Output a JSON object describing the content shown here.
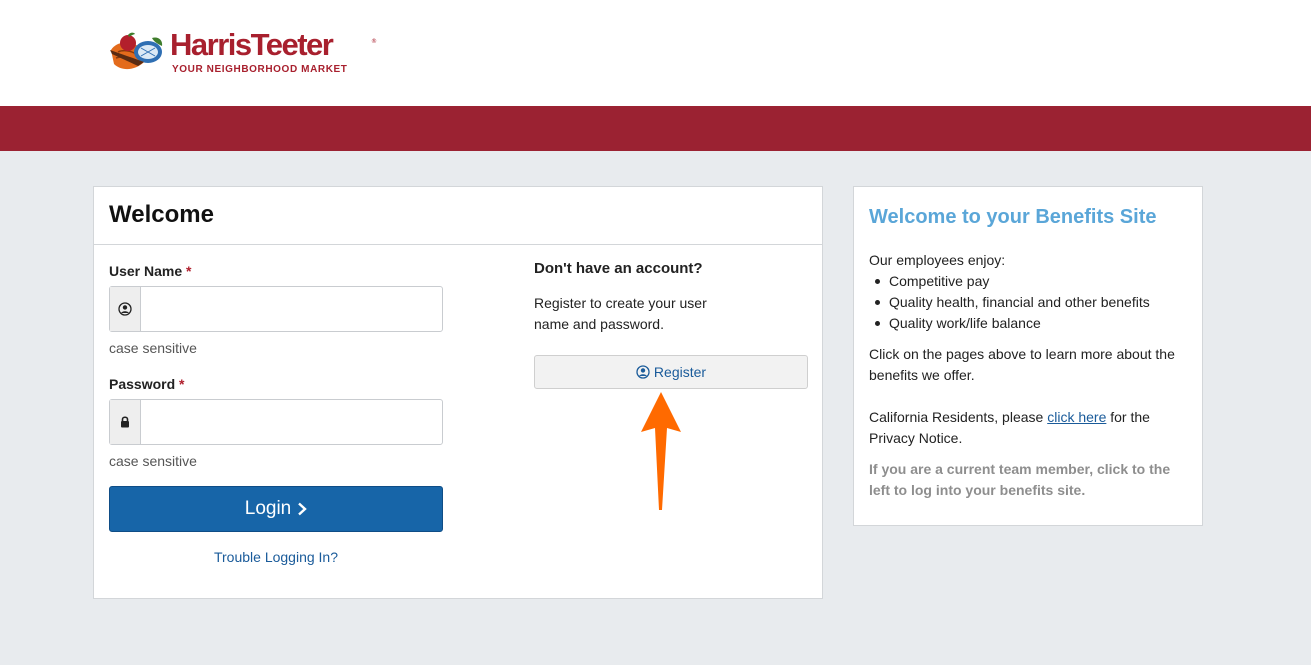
{
  "header": {
    "brand_name": "HarrisTeeter",
    "brand_tagline": "YOUR NEIGHBORHOOD MARKET",
    "brand_color": "#a8202e",
    "band_color": "#9b2232"
  },
  "login_card": {
    "title": "Welcome",
    "username_label": "User Name",
    "username_value": "",
    "username_hint": "case sensitive",
    "password_label": "Password",
    "password_value": "",
    "password_hint": "case sensitive",
    "required_mark": "*",
    "login_button": "Login",
    "trouble_link": "Trouble Logging In?",
    "user_icon": "user-circle-icon",
    "lock_icon": "lock-icon",
    "chevron_icon": "chevron-right-icon"
  },
  "register": {
    "heading": "Don't have an account?",
    "text": "Register to create your user name and password.",
    "button": "Register",
    "icon": "user-circle-icon",
    "annotation": "orange-arrow-pointing-up"
  },
  "info_card": {
    "title": "Welcome to your Benefits Site",
    "intro": "Our employees enjoy:",
    "benefits": [
      "Competitive pay",
      "Quality health, financial and other benefits",
      "Quality work/life balance"
    ],
    "learn_more": "Click on the pages above to learn more about the benefits we offer.",
    "california_before": "California Residents, please ",
    "california_link": "click here",
    "california_after": " for the Privacy Notice.",
    "team_member_note": "If you are a current team member, click to the left to log into your benefits site."
  }
}
